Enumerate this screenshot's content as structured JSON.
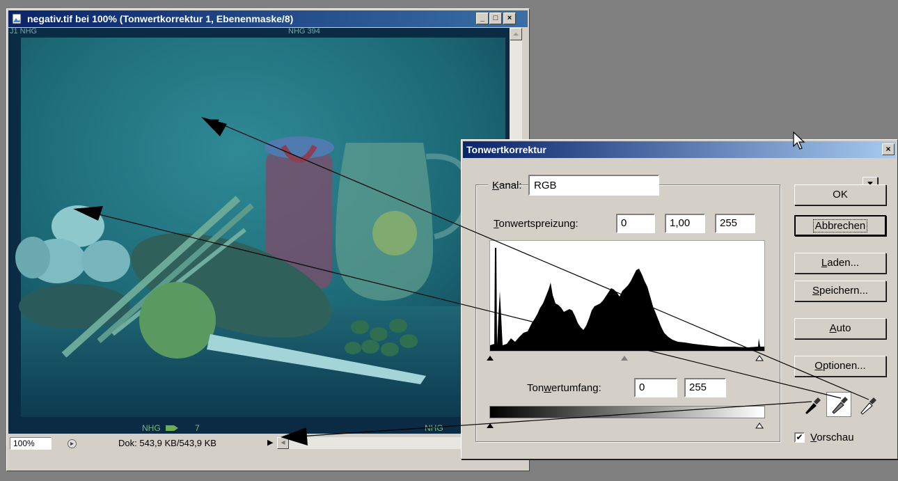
{
  "document_window": {
    "title": "negativ.tif bei 100% (Tonwertkorrektur 1, Ebenenmaske/8)",
    "minimize_label": "_",
    "maximize_label": "□",
    "close_label": "×",
    "film_labels": {
      "top_left": "J1 NHG",
      "top_mid": "NHG 394",
      "bottom_mid": "NHG",
      "bottom_frame": "7",
      "bottom_right": "NHG"
    },
    "zoom": "100%",
    "doc_info": "Dok: 543,9 KB/543,9 KB"
  },
  "dialog": {
    "title": "Tonwertkorrektur",
    "close_label": "×",
    "kanal_label_u": "K",
    "kanal_label_rest": "anal:",
    "kanal_value": "RGB",
    "spreizung_label_u": "T",
    "spreizung_label_rest": "onwertspreizung:",
    "input_black": "0",
    "input_gamma": "1,00",
    "input_white": "255",
    "umfang_label_pre": "Ton",
    "umfang_label_u": "w",
    "umfang_label_rest": "ertumfang:",
    "output_black": "0",
    "output_white": "255",
    "buttons": {
      "ok": "OK",
      "cancel": "Abbrechen",
      "load_u": "L",
      "load_rest": "aden...",
      "save_u": "S",
      "save_rest": "peichern...",
      "auto_u": "A",
      "auto_rest": "uto",
      "options_u": "O",
      "options_rest": "ptionen..."
    },
    "preview_u": "V",
    "preview_rest": "orschau",
    "preview_checked": "✔"
  }
}
